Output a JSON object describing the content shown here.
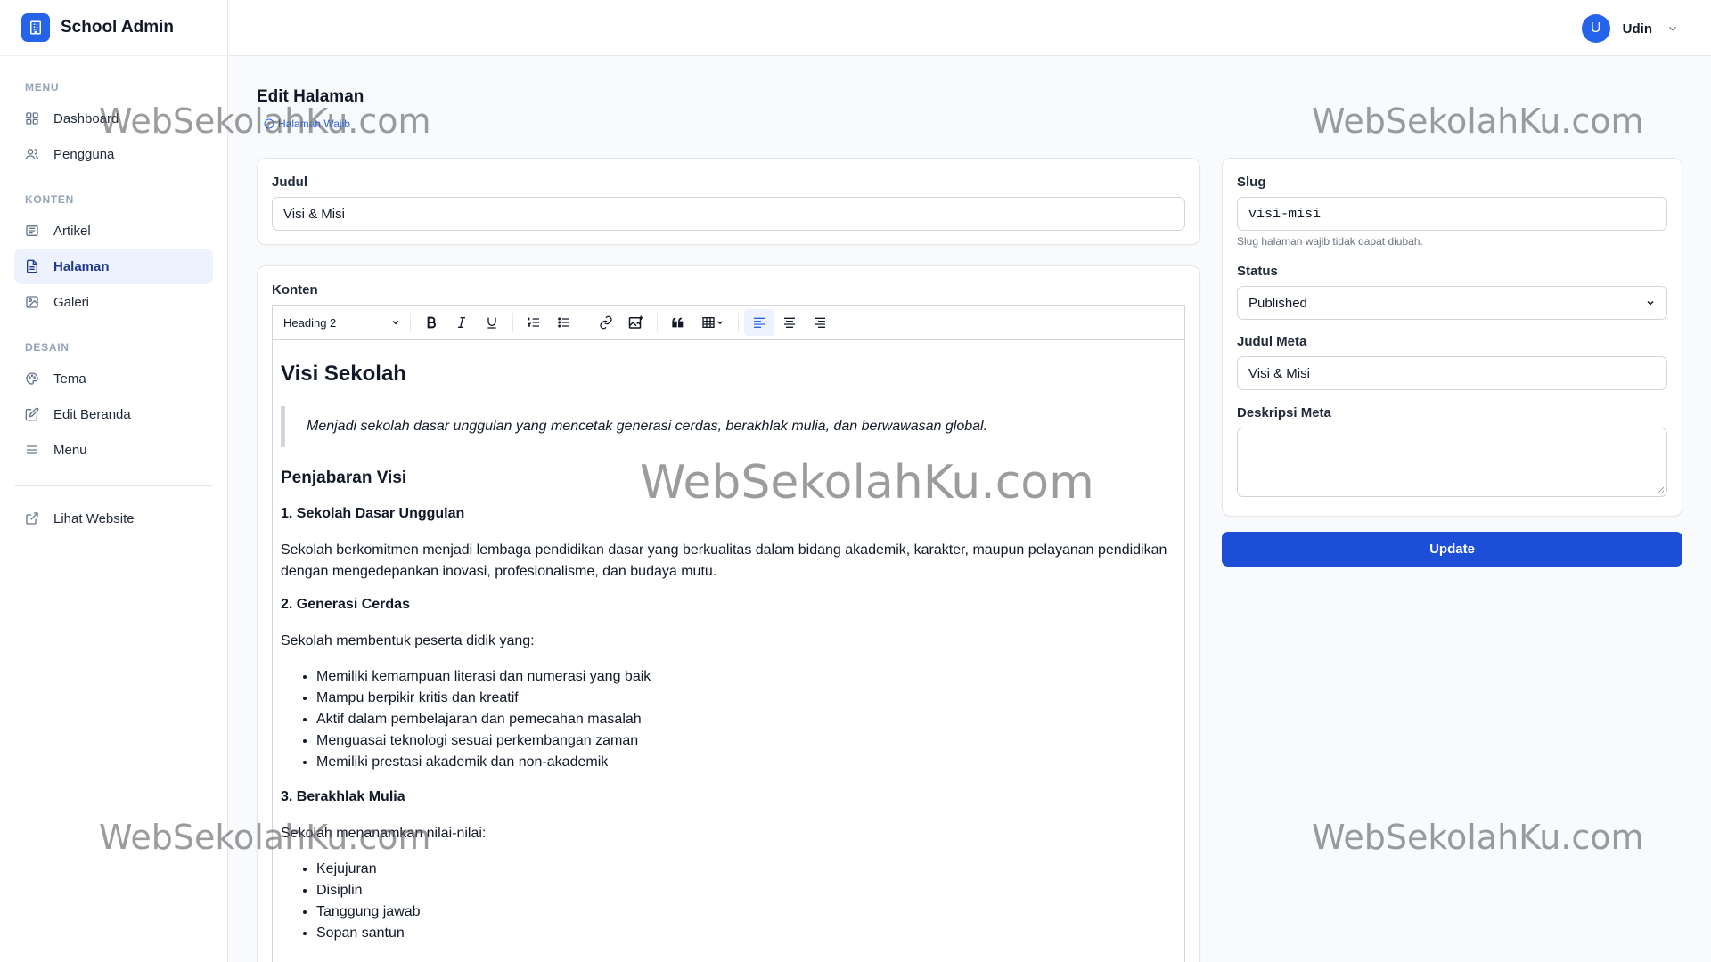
{
  "app": {
    "name": "School Admin"
  },
  "sidebar": {
    "sections": [
      {
        "title": "MENU",
        "items": [
          {
            "label": "Dashboard",
            "icon": "grid-icon"
          },
          {
            "label": "Pengguna",
            "icon": "users-icon"
          }
        ]
      },
      {
        "title": "KONTEN",
        "items": [
          {
            "label": "Artikel",
            "icon": "newspaper-icon"
          },
          {
            "label": "Halaman",
            "icon": "document-icon",
            "active": true
          },
          {
            "label": "Galeri",
            "icon": "image-icon"
          }
        ]
      },
      {
        "title": "DESAIN",
        "items": [
          {
            "label": "Tema",
            "icon": "palette-icon"
          },
          {
            "label": "Edit Beranda",
            "icon": "edit-icon"
          },
          {
            "label": "Menu",
            "icon": "menu-icon"
          }
        ]
      }
    ],
    "external": {
      "label": "Lihat Website",
      "icon": "external-link-icon"
    }
  },
  "user": {
    "initial": "U",
    "name": "Udin"
  },
  "page": {
    "title": "Edit Halaman",
    "badge": "Halaman Wajib"
  },
  "form": {
    "title_label": "Judul",
    "title_value": "Visi & Misi",
    "content_label": "Konten",
    "slug_label": "Slug",
    "slug_value": "visi-misi",
    "slug_hint": "Slug halaman wajib tidak dapat diubah.",
    "status_label": "Status",
    "status_value": "Published",
    "meta_title_label": "Judul Meta",
    "meta_title_value": "Visi & Misi",
    "meta_desc_label": "Deskripsi Meta",
    "meta_desc_value": "",
    "submit_label": "Update"
  },
  "toolbar": {
    "heading_value": "Heading 2"
  },
  "editor": {
    "h2": "Visi Sekolah",
    "quote": "Menjadi sekolah dasar unggulan yang mencetak generasi cerdas, berakhlak mulia, dan berwawasan global.",
    "h3": "Penjabaran Visi",
    "s1_title": "1. Sekolah Dasar Unggulan",
    "s1_text": "Sekolah berkomitmen menjadi lembaga pendidikan dasar yang berkualitas dalam bidang akademik, karakter, maupun pelayanan pendidikan dengan mengedepankan inovasi, profesionalisme, dan budaya mutu.",
    "s2_title": "2. Generasi Cerdas",
    "s2_text": "Sekolah membentuk peserta didik yang:",
    "s2_list": [
      "Memiliki kemampuan literasi dan numerasi yang baik",
      "Mampu berpikir kritis dan kreatif",
      "Aktif dalam pembelajaran dan pemecahan masalah",
      "Menguasai teknologi sesuai perkembangan zaman",
      "Memiliki prestasi akademik dan non-akademik"
    ],
    "s3_title": "3. Berakhlak Mulia",
    "s3_text": "Sekolah menanamkan nilai-nilai:",
    "s3_list": [
      "Kejujuran",
      "Disiplin",
      "Tanggung jawab",
      "Sopan santun"
    ]
  },
  "watermark": "WebSekolahKu.com",
  "colors": {
    "primary": "#2563eb",
    "button": "#1d4ed8",
    "active_nav_bg": "#eef2ff"
  }
}
